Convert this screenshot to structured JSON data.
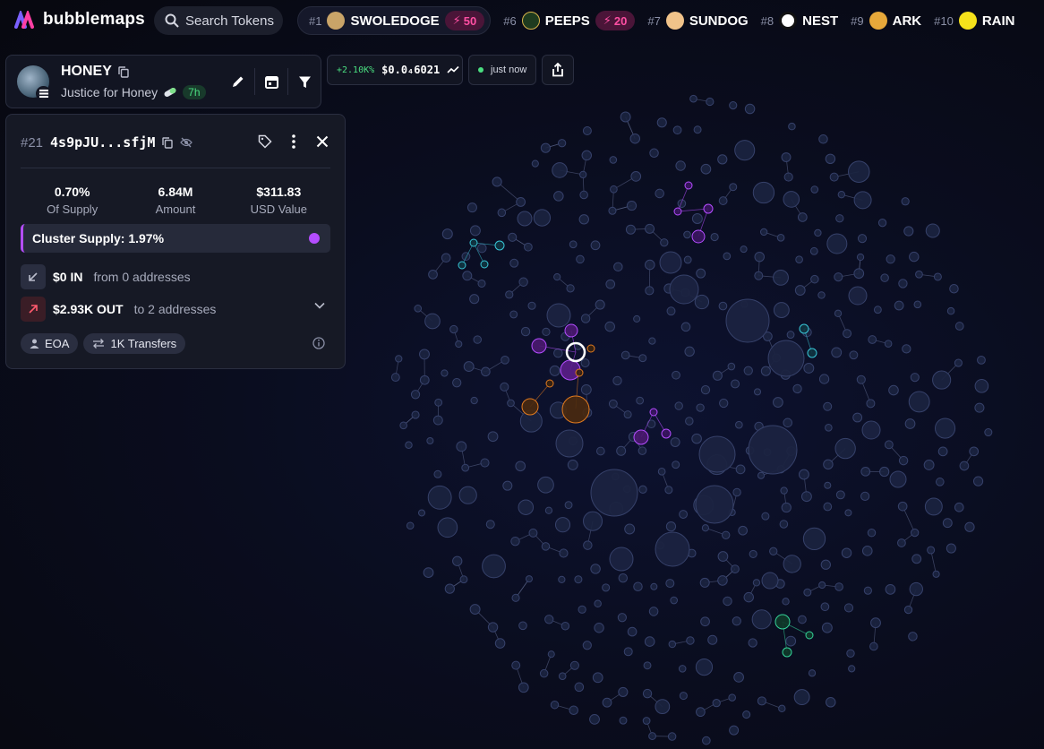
{
  "app": {
    "brand": "bubblemaps"
  },
  "search": {
    "label": "Search Tokens"
  },
  "trending": [
    {
      "rank": "#1",
      "name": "SWOLEDOGE",
      "boost": "50",
      "avatar_color": "#c9a468"
    },
    {
      "rank": "#6",
      "name": "PEEPS",
      "boost": "20",
      "avatar_color": "#1f3b1f"
    },
    {
      "rank": "#7",
      "name": "SUNDOG",
      "boost": "",
      "avatar_color": "#f1c38a"
    },
    {
      "rank": "#8",
      "name": "NEST",
      "boost": "",
      "avatar_color": "#ffffff"
    },
    {
      "rank": "#9",
      "name": "ARK",
      "boost": "",
      "avatar_color": "#e7a83a"
    },
    {
      "rank": "#10",
      "name": "RAIN",
      "boost": "",
      "avatar_color": "#f5e21b"
    }
  ],
  "token": {
    "name": "HONEY",
    "subtitle": "Justice for Honey",
    "age": "7h"
  },
  "price": {
    "change": "+2.10K%",
    "value": "$0.0₄6021"
  },
  "refresh": {
    "label": "just now"
  },
  "wallet": {
    "rank": "#21",
    "address": "4s9pJU...sfjM",
    "stats": [
      {
        "value": "0.70%",
        "label": "Of Supply"
      },
      {
        "value": "6.84M",
        "label": "Amount"
      },
      {
        "value": "$311.83",
        "label": "USD Value"
      }
    ],
    "cluster_label": "Cluster Supply: 1.97%",
    "inflow": {
      "amount": "$0 IN",
      "detail": "from 0 addresses"
    },
    "outflow": {
      "amount": "$2.93K OUT",
      "detail": "to 2 addresses"
    },
    "tags": [
      "EOA",
      "1K Transfers"
    ]
  },
  "colors": {
    "accent_purple": "#b44dff",
    "boost_pink": "#ff4fa3",
    "positive": "#4ade80",
    "bubble": "#1b2340",
    "bubble_stroke": "#36416a",
    "cluster_orange": "#e07a1f",
    "cluster_cyan": "#38c5d6",
    "cluster_green": "#34d399"
  }
}
